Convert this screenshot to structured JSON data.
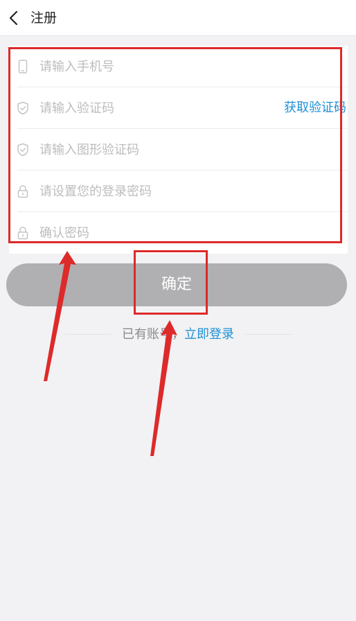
{
  "header": {
    "title": "注册",
    "back_icon": "chevron-left-icon"
  },
  "form": {
    "fields": [
      {
        "icon": "phone-icon",
        "placeholder": "请输入手机号"
      },
      {
        "icon": "shield-check-icon",
        "placeholder": "请输入验证码"
      },
      {
        "icon": "shield-check-icon",
        "placeholder": "请输入图形验证码"
      },
      {
        "icon": "lock-icon",
        "placeholder": "请设置您的登录密码"
      },
      {
        "icon": "lock-icon",
        "placeholder": "确认密码"
      }
    ],
    "get_code_label": "获取验证码"
  },
  "confirm_button": {
    "label": "确定"
  },
  "login_prompt": {
    "prefix": "已有账号，",
    "link": "立即登录"
  },
  "colors": {
    "accent": "#1e90d6",
    "annotation": "#dd2a2a",
    "button_disabled": "#b0afb1"
  }
}
